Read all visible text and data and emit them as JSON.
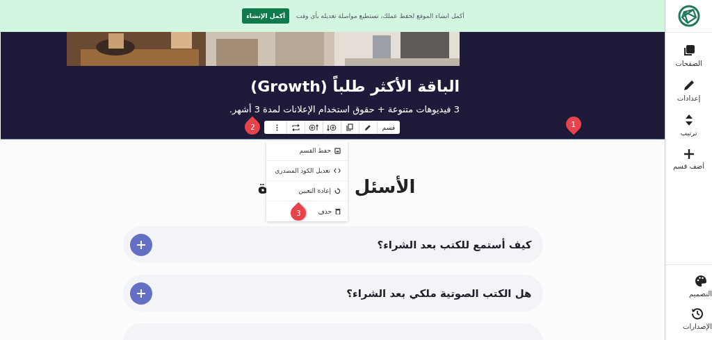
{
  "banner": {
    "message": "أكمل انشاء الموقع لحفظ عملك، تستطيع مواصلة تعديله بأي وقت",
    "button": "أكمل الإنشاء"
  },
  "hero": {
    "title": "الباقة الأكثر طلباً (Growth)",
    "subtitle": "3 فيديوهات متنوعة + حقوق استخدام الإعلانات لمدة 3 أشهر."
  },
  "section_toolbar": {
    "label": "قسم"
  },
  "section_menu": {
    "items": [
      {
        "label": "حفظ القسم",
        "kind": "save"
      },
      {
        "label": "تعديل الكود المصدري",
        "kind": "code"
      },
      {
        "label": "إعادة التعيين",
        "kind": "reset"
      },
      {
        "label": "حذف",
        "kind": "delete"
      }
    ]
  },
  "faq": {
    "heading_parts": [
      "الأسئل",
      "ة"
    ],
    "items": [
      {
        "question": "كيف أستمع للكتب بعد الشراء؟",
        "expanded": false
      },
      {
        "question": "هل الكتب الصوتية ملكي بعد الشراء؟",
        "expanded": false
      }
    ]
  },
  "callouts": [
    "1",
    "2",
    "3"
  ],
  "sidebar": {
    "top_items": [
      {
        "label": "الصفحات",
        "kind": "pages"
      },
      {
        "label": "إعدادات",
        "kind": "settings"
      },
      {
        "label": "ترتيب",
        "kind": "order"
      },
      {
        "label": "أضف قسم",
        "kind": "add"
      }
    ],
    "bottom_items": [
      {
        "label": "التصميم",
        "kind": "design"
      },
      {
        "label": "الإصدارات",
        "kind": "versions"
      }
    ]
  }
}
